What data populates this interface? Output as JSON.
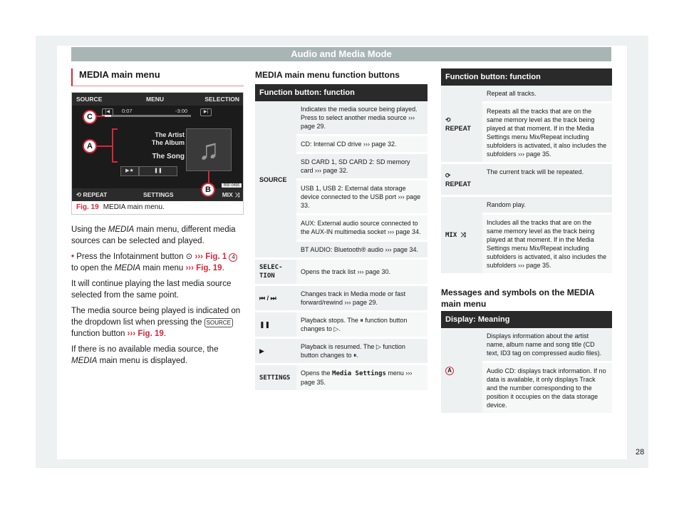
{
  "header": {
    "title": "Audio and Media Mode"
  },
  "left": {
    "section_title": "MEDIA main menu",
    "figure": {
      "screen": {
        "top_buttons": [
          "SOURCE",
          "MENU",
          "SELECTION"
        ],
        "bottom_buttons": [
          "REPEAT",
          "SETTINGS",
          "MIX"
        ],
        "elapsed": "0:07",
        "remaining": "-3:00",
        "progress_fraction": 0.1,
        "artist": "The Artist",
        "album": "The Album",
        "song": "The Song",
        "callouts": [
          "C",
          "A",
          "B"
        ],
        "code": "B5F-0496"
      },
      "caption_fig": "Fig. 19",
      "caption_text": "MEDIA main menu."
    },
    "paragraphs": {
      "p1_a": "Using the ",
      "p1_em": "MEDIA",
      "p1_b": " main menu, different media sources can be selected and played.",
      "bullet_a": "Press the Infotainment button ",
      "bullet_ref1": "››› Fig. 1",
      "bullet_num": "4",
      "bullet_b": " to open the ",
      "bullet_em": "MEDIA",
      "bullet_c": " main menu ",
      "bullet_ref2": "››› Fig. 19",
      "bullet_d": ".",
      "p2": "It will continue playing the last media source selected from the same point.",
      "p3_a": "The media source being played is indicated on the dropdown list when pressing the ",
      "p3_tag": "SOURCE",
      "p3_b": " function button ",
      "p3_ref": "››› Fig. 19",
      "p3_c": ".",
      "p4_a": "If there is no available media source, the ",
      "p4_em": "MEDIA",
      "p4_b": " main menu is displayed."
    }
  },
  "middle": {
    "section_title": "MEDIA main menu function buttons",
    "table_header": "Function button: function",
    "source_key": "SOURCE",
    "source_rows": [
      "Indicates the media source being played. Press to select another media source ››› page 29.",
      "CD: Internal CD drive ››› page 32.",
      "SD CARD 1, SD CARD 2: SD memory card ››› page 32.",
      "USB 1, USB 2: External data storage device connected to the USB port ››› page 33.",
      "AUX: External audio source connected to the AUX-IN multimedia socket ››› page 34.",
      "BT AUDIO: Bluetooth® audio ››› page 34."
    ],
    "rows": [
      {
        "key": "SELEC-TION",
        "desc": "Opens the track list ››› page 30."
      },
      {
        "key": "⏮ / ⏭",
        "desc": "Changes track in Media mode or fast forward/rewind ››› page 29."
      },
      {
        "key": "❚❚",
        "desc": "Playback stops. The ⏸ function button changes to ▷."
      },
      {
        "key": "▶",
        "desc": "Playback is resumed. The ▷ function button changes to ⏸."
      },
      {
        "key": "SETTINGS",
        "desc_a": "Opens the ",
        "desc_mono": "Media Settings",
        "desc_b": " menu ››› page 35."
      }
    ]
  },
  "right": {
    "table_header": "Function button: function",
    "repeat_all_key": "REPEAT",
    "repeat_all_rows": [
      "Repeat all tracks.",
      "Repeats all the tracks that are on the same memory level as the track being played at that moment. If in the Media Settings menu Mix/Repeat including subfolders is activated, it also includes the subfolders ››› page 35."
    ],
    "repeat_one_key": "REPEAT",
    "repeat_one_desc": "The current track will be repeated.",
    "mix_key": "MIX",
    "mix_rows": [
      "Random play.",
      "Includes all the tracks that are on the same memory level as the track being played at that moment. If in the Media Settings menu Mix/Repeat including subfolders is activated, it also includes the subfolders ››› page 35."
    ],
    "section_title": "Messages and symbols on the MEDIA main menu",
    "display_header": "Display: Meaning",
    "display_key": "A",
    "display_rows": [
      "Displays information about the artist name, album name and song title (CD text, ID3 tag on compressed audio files).",
      "Audio CD: displays track information. If no data is available, it only displays Track and the number corresponding to the position it occupies on the data storage device."
    ]
  },
  "page_number": "28"
}
